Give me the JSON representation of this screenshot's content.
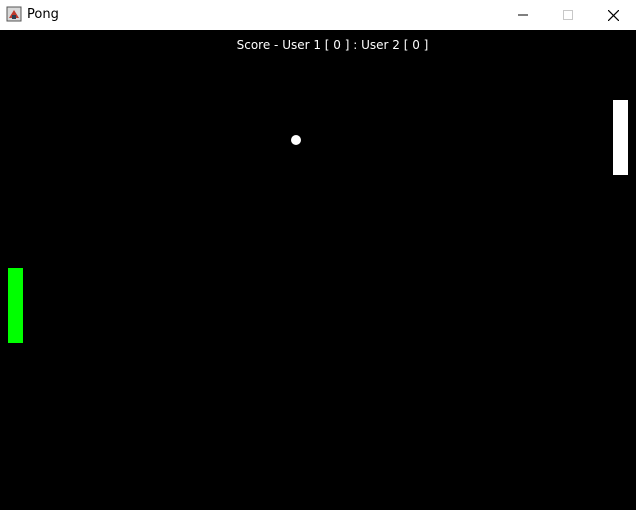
{
  "window": {
    "title": "Pong",
    "icon": "java-app-icon",
    "controls": {
      "minimize_icon": "minimize-icon",
      "maximize_icon": "maximize-icon",
      "close_icon": "close-icon"
    }
  },
  "game": {
    "score_text": "Score - User 1 [ 0 ] : User 2 [ 0 ]",
    "user1_score": 0,
    "user2_score": 0,
    "colors": {
      "background": "#000000",
      "left_paddle": "#00ff00",
      "right_paddle": "#ffffff",
      "ball": "#ffffff",
      "score_text": "#ffffff"
    }
  }
}
